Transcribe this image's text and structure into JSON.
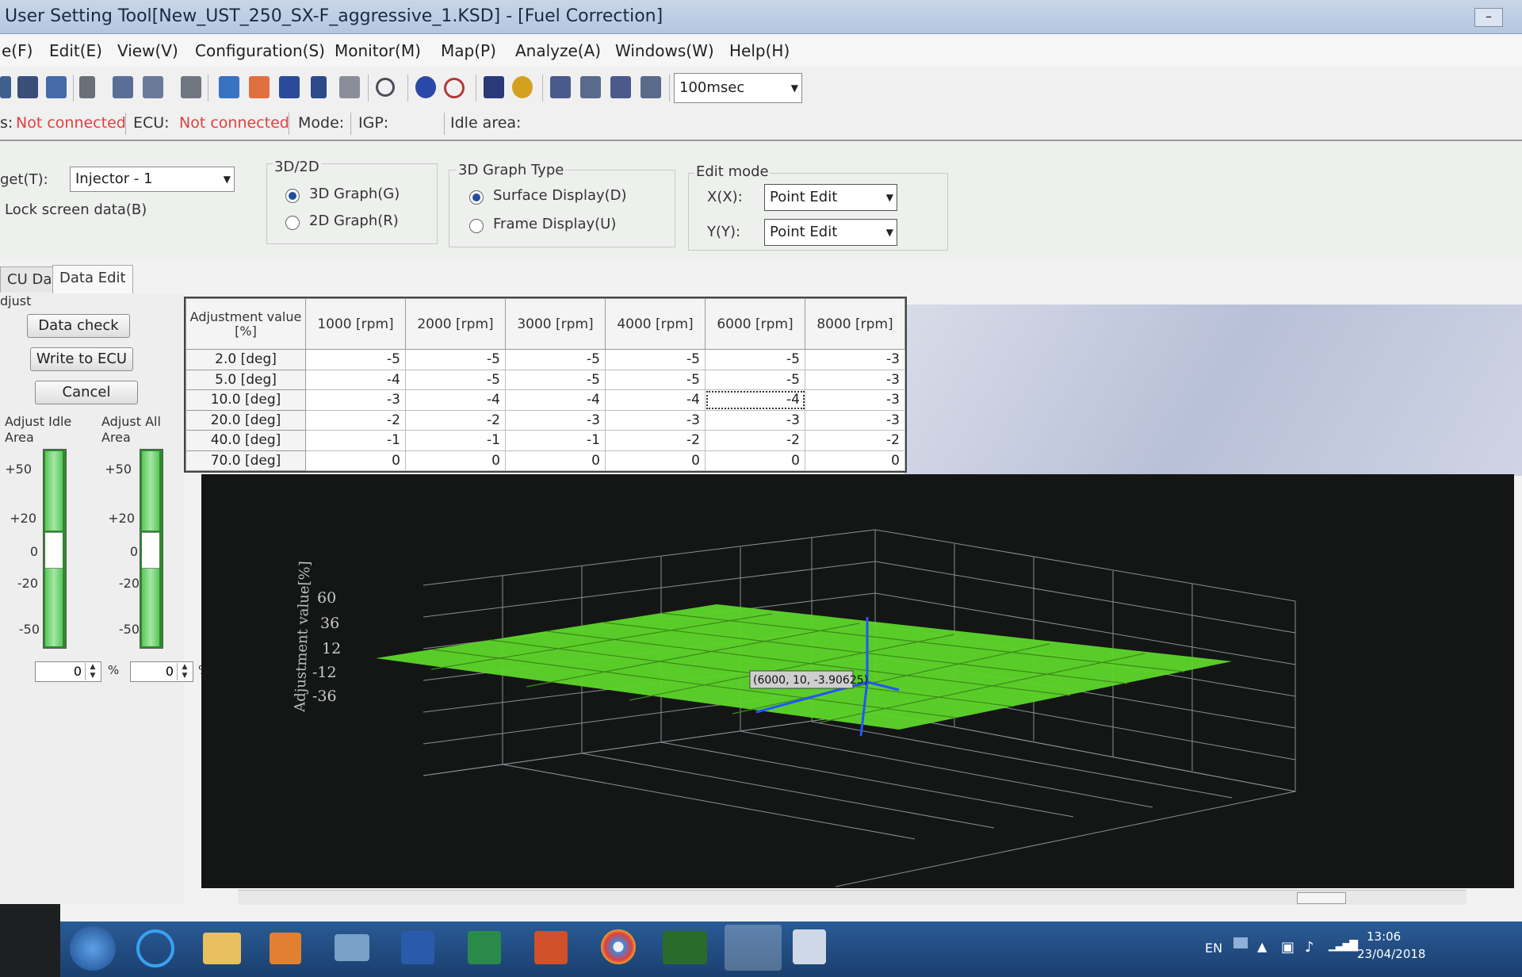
{
  "window": {
    "title": "User Setting Tool[New_UST_250_SX-F_aggressive_1.KSD] - [Fuel Correction]",
    "minimize": "–"
  },
  "menu": [
    "e(F)",
    "Edit(E)",
    "View(V)",
    "Configuration(S)",
    "Monitor(M)",
    "Map(P)",
    "Analyze(A)",
    "Windows(W)",
    "Help(H)"
  ],
  "toolbar": {
    "interval_value": "100msec"
  },
  "status": {
    "conn_label": "s:",
    "conn_value": "Not connected",
    "ecu_label": "ECU:",
    "ecu_value": "Not connected",
    "mode_label": "Mode:",
    "igp_label": "IGP:",
    "idle_label": "Idle area:"
  },
  "settings": {
    "target_label": "get(T):",
    "target_value": "Injector - 1",
    "lock_label": "Lock screen data(B)",
    "g3d2d_title": "3D/2D",
    "opt_3d": "3D Graph(G)",
    "opt_2d": "2D Graph(R)",
    "graphtype_title": "3D Graph Type",
    "opt_surface": "Surface Display(D)",
    "opt_frame": "Frame Display(U)",
    "editmode_title": "Edit mode",
    "x_label": "X(X):",
    "x_value": "Point Edit",
    "y_label": "Y(Y):",
    "y_value": "Point Edit"
  },
  "tabs": {
    "ecu_data": "CU Data",
    "data_edit": "Data Edit"
  },
  "left": {
    "adjust_title": "djust",
    "data_check": "Data check",
    "write_ecu": "Write to ECU",
    "cancel": "Cancel",
    "idle_area_label": "Adjust Idle Area",
    "all_area_label": "Adjust All Area",
    "ticks": [
      "+50",
      "+20",
      "0",
      "-20",
      "-50"
    ],
    "idle_value": "0",
    "all_value": "0",
    "unit": "%"
  },
  "table": {
    "corner": "Adjustment value [%]",
    "columns": [
      "1000 [rpm]",
      "2000 [rpm]",
      "3000 [rpm]",
      "4000 [rpm]",
      "6000 [rpm]",
      "8000 [rpm]"
    ],
    "rows": [
      {
        "label": "2.0 [deg]",
        "values": [
          "-5",
          "-5",
          "-5",
          "-5",
          "-5",
          "-3"
        ]
      },
      {
        "label": "5.0 [deg]",
        "values": [
          "-4",
          "-5",
          "-5",
          "-5",
          "-5",
          "-3"
        ]
      },
      {
        "label": "10.0 [deg]",
        "values": [
          "-3",
          "-4",
          "-4",
          "-4",
          "-4",
          "-3"
        ]
      },
      {
        "label": "20.0 [deg]",
        "values": [
          "-2",
          "-2",
          "-3",
          "-3",
          "-3",
          "-3"
        ]
      },
      {
        "label": "40.0 [deg]",
        "values": [
          "-1",
          "-1",
          "-1",
          "-2",
          "-2",
          "-2"
        ]
      },
      {
        "label": "70.0 [deg]",
        "values": [
          "0",
          "0",
          "0",
          "0",
          "0",
          "0"
        ]
      }
    ]
  },
  "graph": {
    "z_axis_label": "Adjustment value[%]",
    "z_ticks": [
      "60",
      "36",
      "12",
      "-12",
      "-36"
    ],
    "tooltip": "(6000, 10, -3.90625)",
    "surface_color": "#5ed62a",
    "cursor_color": "#2255ff"
  },
  "taskbar": {
    "lang": "EN",
    "time": "13:06",
    "date": "23/04/2018"
  }
}
